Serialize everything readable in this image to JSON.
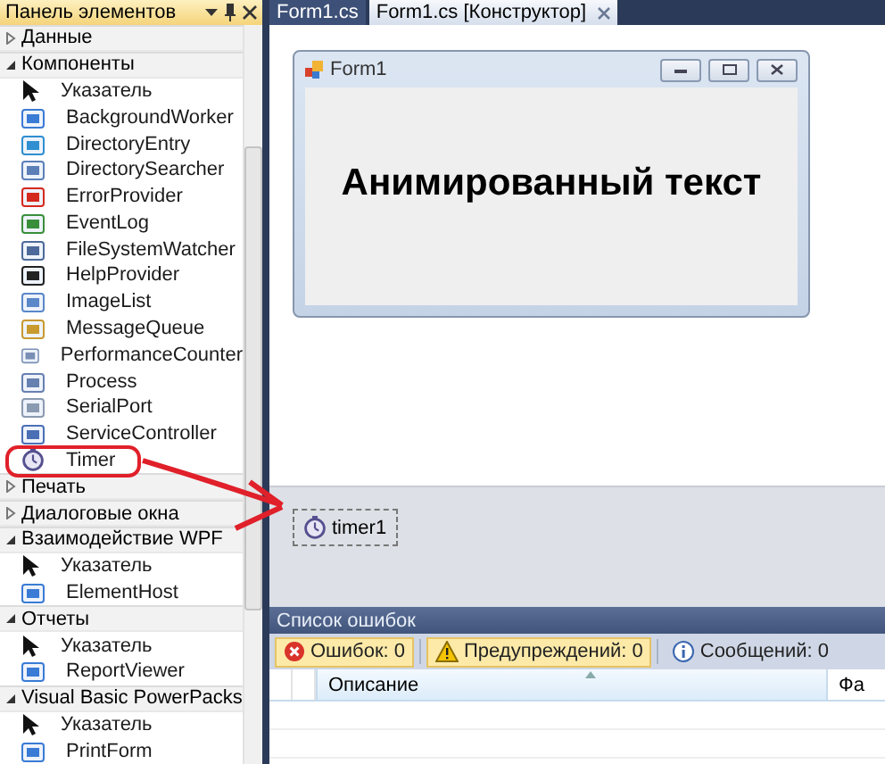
{
  "toolbox": {
    "title": "Панель элементов",
    "groups": [
      {
        "name": "Данные",
        "expanded": false
      },
      {
        "name": "Компоненты",
        "expanded": true,
        "items": [
          {
            "label": "Указатель",
            "kind": "pointer"
          },
          {
            "label": "BackgroundWorker",
            "kind": "component"
          },
          {
            "label": "DirectoryEntry",
            "kind": "component"
          },
          {
            "label": "DirectorySearcher",
            "kind": "component"
          },
          {
            "label": "ErrorProvider",
            "kind": "component"
          },
          {
            "label": "EventLog",
            "kind": "component"
          },
          {
            "label": "FileSystemWatcher",
            "kind": "component"
          },
          {
            "label": "HelpProvider",
            "kind": "component"
          },
          {
            "label": "ImageList",
            "kind": "component"
          },
          {
            "label": "MessageQueue",
            "kind": "component"
          },
          {
            "label": "PerformanceCounter",
            "kind": "component"
          },
          {
            "label": "Process",
            "kind": "component"
          },
          {
            "label": "SerialPort",
            "kind": "component"
          },
          {
            "label": "ServiceController",
            "kind": "component"
          },
          {
            "label": "Timer",
            "kind": "timer"
          }
        ]
      },
      {
        "name": "Печать",
        "expanded": false
      },
      {
        "name": "Диалоговые окна",
        "expanded": false
      },
      {
        "name": "Взаимодействие WPF",
        "expanded": true,
        "items": [
          {
            "label": "Указатель",
            "kind": "pointer"
          },
          {
            "label": "ElementHost",
            "kind": "component"
          }
        ]
      },
      {
        "name": "Отчеты",
        "expanded": true,
        "items": [
          {
            "label": "Указатель",
            "kind": "pointer"
          },
          {
            "label": "ReportViewer",
            "kind": "component"
          }
        ]
      },
      {
        "name": "Visual Basic PowerPacks",
        "expanded": true,
        "items": [
          {
            "label": "Указатель",
            "kind": "pointer"
          },
          {
            "label": "PrintForm",
            "kind": "component"
          }
        ]
      }
    ]
  },
  "tabs": [
    {
      "label": "Form1.cs",
      "selected": false
    },
    {
      "label": "Form1.cs [Конструктор]",
      "selected": true
    }
  ],
  "form": {
    "title": "Form1",
    "label": "Анимированный текст"
  },
  "tray": {
    "components": [
      "timer1"
    ]
  },
  "error_list": {
    "title": "Список ошибок",
    "filters": [
      {
        "kind": "error",
        "label": "Ошибок: 0",
        "selected": true
      },
      {
        "kind": "warning",
        "label": "Предупреждений: 0",
        "selected": true
      },
      {
        "kind": "info",
        "label": "Сообщений: 0",
        "selected": false
      }
    ],
    "columns": [
      "Описание",
      "Фа"
    ]
  }
}
